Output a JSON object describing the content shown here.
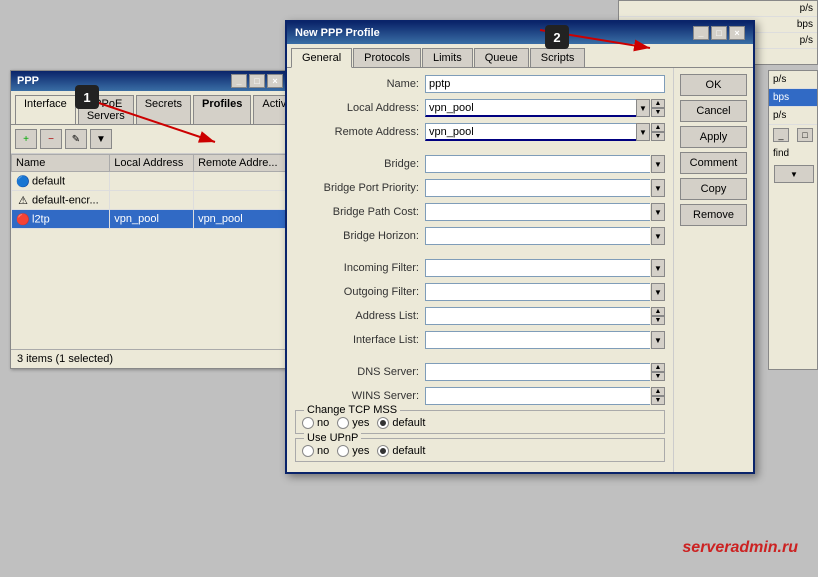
{
  "ppp_window": {
    "title": "PPP",
    "tabs": [
      "Interface",
      "PPPoE Servers",
      "Secrets",
      "Profiles",
      "Activ"
    ],
    "active_tab": "Profiles",
    "columns": [
      "Name",
      "Local Address",
      "Remote Addre..."
    ],
    "rows": [
      {
        "name": "default",
        "local": "",
        "remote": "",
        "icon": "default",
        "selected": false
      },
      {
        "name": "default-encr...",
        "local": "",
        "remote": "",
        "icon": "warning",
        "selected": false
      },
      {
        "name": "l2tp",
        "local": "vpn_pool",
        "remote": "vpn_pool",
        "icon": "l2tp",
        "selected": true
      }
    ],
    "status": "3 items (1 selected)"
  },
  "dialog": {
    "title": "New PPP Profile",
    "tabs": [
      "General",
      "Protocols",
      "Limits",
      "Queue",
      "Scripts"
    ],
    "active_tab": "General",
    "fields": {
      "name": {
        "label": "Name:",
        "value": "pptp"
      },
      "local_address": {
        "label": "Local Address:",
        "value": "vpn_pool"
      },
      "remote_address": {
        "label": "Remote Address:",
        "value": "vpn_pool"
      },
      "bridge": {
        "label": "Bridge:",
        "value": ""
      },
      "bridge_port_priority": {
        "label": "Bridge Port Priority:",
        "value": ""
      },
      "bridge_path_cost": {
        "label": "Bridge Path Cost:",
        "value": ""
      },
      "bridge_horizon": {
        "label": "Bridge Horizon:",
        "value": ""
      },
      "incoming_filter": {
        "label": "Incoming Filter:",
        "value": ""
      },
      "outgoing_filter": {
        "label": "Outgoing Filter:",
        "value": ""
      },
      "address_list": {
        "label": "Address List:",
        "value": ""
      },
      "interface_list": {
        "label": "Interface List:",
        "value": ""
      },
      "dns_server": {
        "label": "DNS Server:",
        "value": ""
      },
      "wins_server": {
        "label": "WINS Server:",
        "value": ""
      }
    },
    "tcp_mss": {
      "label": "Change TCP MSS",
      "options": [
        "no",
        "yes",
        "default"
      ],
      "selected": "default"
    },
    "upnp": {
      "label": "Use UPnP",
      "options": [
        "no",
        "yes",
        "default"
      ],
      "selected": "default"
    },
    "buttons": [
      "OK",
      "Cancel",
      "Apply",
      "Comment",
      "Copy",
      "Remove"
    ]
  },
  "badges": {
    "one": "1",
    "two": "2"
  },
  "watermark": "serveradmin.ru",
  "right_panel_items": [
    "p/s",
    "bps",
    "p/s"
  ],
  "top_bar_items": [
    "",
    ""
  ]
}
